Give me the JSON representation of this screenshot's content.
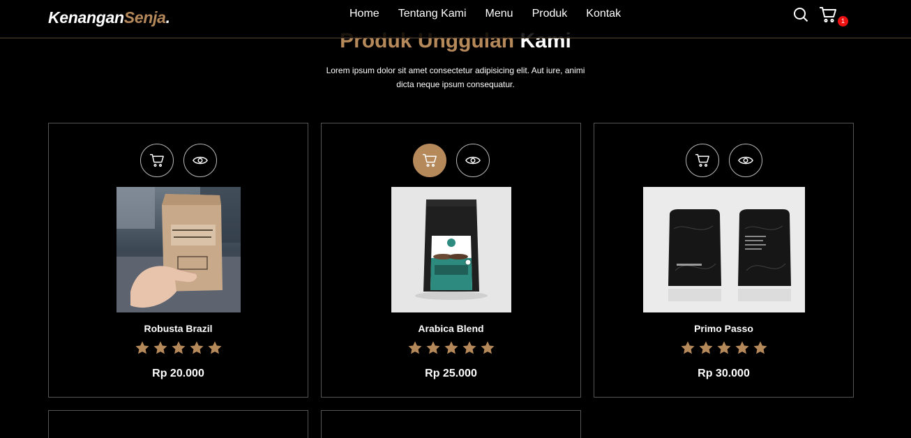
{
  "logo": {
    "main": "Kenangan",
    "accent": "Senja",
    "dot": "."
  },
  "nav": [
    "Home",
    "Tentang Kami",
    "Menu",
    "Produk",
    "Kontak"
  ],
  "cart_count": "1",
  "section": {
    "title_part1": "Produk Unggulan",
    "title_part2": "Kami",
    "subtitle": "Lorem ipsum dolor sit amet consectetur adipisicing elit. Aut iure, animi dicta neque ipsum consequatur."
  },
  "products": [
    {
      "name": "Robusta Brazil",
      "price": "Rp 20.000",
      "rating": 5
    },
    {
      "name": "Arabica Blend",
      "price": "Rp 25.000",
      "rating": 5
    },
    {
      "name": "Primo Passo",
      "price": "Rp 30.000",
      "rating": 5
    }
  ],
  "colors": {
    "accent": "#b6895b",
    "background": "#000000",
    "badge": "#ee1111"
  },
  "icons": [
    "search-icon",
    "cart-icon",
    "eye-icon",
    "star-icon"
  ]
}
